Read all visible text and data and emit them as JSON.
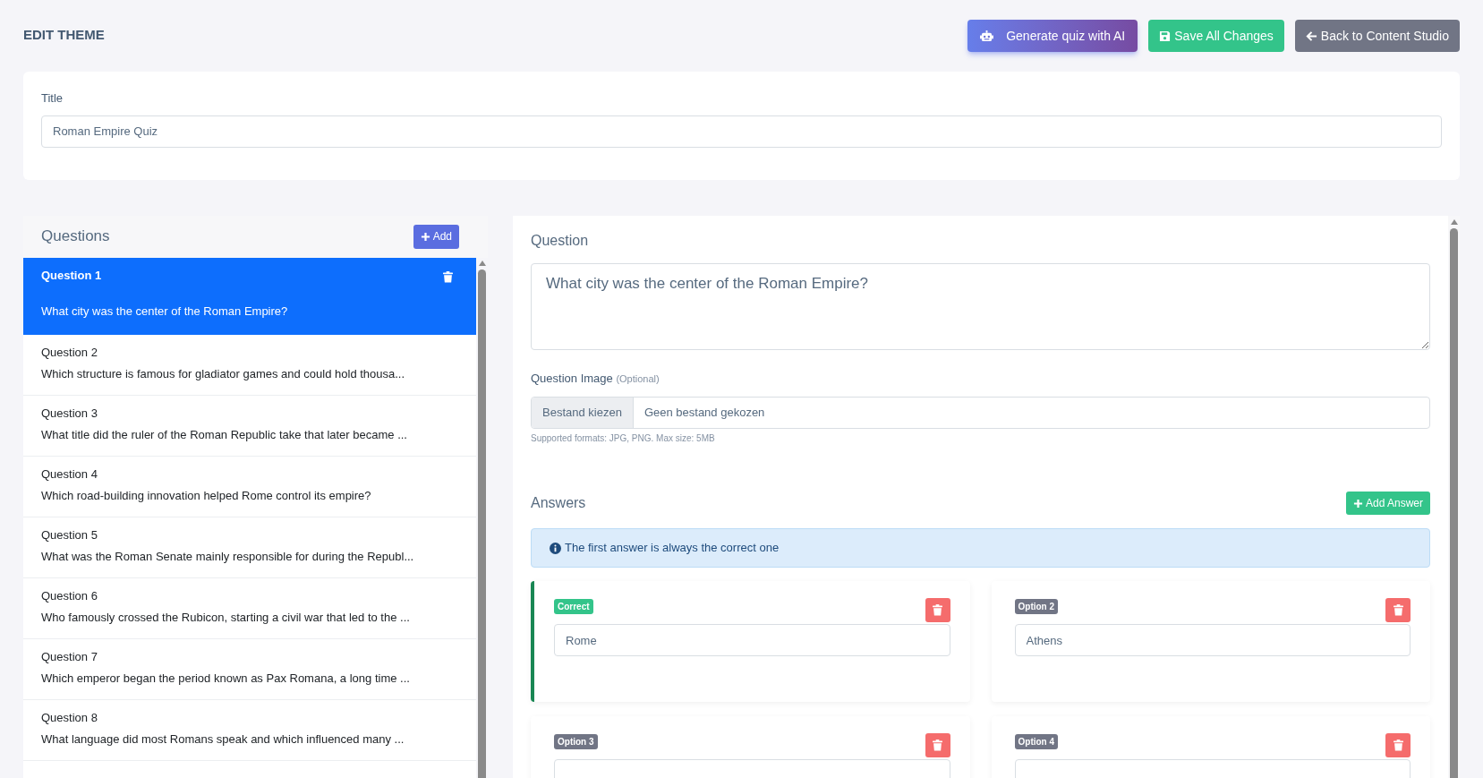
{
  "header": {
    "title": "EDIT THEME",
    "buttons": [
      {
        "kind": "ai",
        "label": "Generate quiz with AI"
      },
      {
        "kind": "save",
        "label": "Save All Changes"
      },
      {
        "kind": "back",
        "label": "Back to Content Studio"
      }
    ]
  },
  "title_field": {
    "label": "Title",
    "value": "Roman Empire Quiz"
  },
  "questions": {
    "heading": "Questions",
    "add_button": "Add",
    "items": [
      {
        "title": "Question 1",
        "text": "What city was the center of the Roman Empire?",
        "selected": true
      },
      {
        "title": "Question 2",
        "text": "Which structure is famous for gladiator games and could hold thousa...",
        "selected": false
      },
      {
        "title": "Question 3",
        "text": "What title did the ruler of the Roman Republic take that later became ...",
        "selected": false
      },
      {
        "title": "Question 4",
        "text": "Which road-building innovation helped Rome control its empire?",
        "selected": false
      },
      {
        "title": "Question 5",
        "text": "What was the Roman Senate mainly responsible for during the Republ...",
        "selected": false
      },
      {
        "title": "Question 6",
        "text": "Who famously crossed the Rubicon, starting a civil war that led to the ...",
        "selected": false
      },
      {
        "title": "Question 7",
        "text": "Which emperor began the period known as Pax Romana, a long time ...",
        "selected": false
      },
      {
        "title": "Question 8",
        "text": "What language did most Romans speak and which influenced many ...",
        "selected": false
      }
    ]
  },
  "editor": {
    "question_label": "Question",
    "question_text": "What city was the center of the Roman Empire?",
    "image_label": "Question Image",
    "image_optional": "(Optional)",
    "file_button": "Bestand kiezen",
    "file_status": "Geen bestand gekozen",
    "hint": "Supported formats: JPG, PNG. Max size: 5MB",
    "answers_heading": "Answers",
    "add_answer": "Add Answer",
    "info": "The first answer is always the correct one",
    "answers": [
      {
        "badge": "Correct",
        "value": "Rome",
        "correct": true
      },
      {
        "badge": "Option 2",
        "value": "Athens",
        "correct": false
      },
      {
        "badge": "Option 3",
        "correct": false
      },
      {
        "badge": "Option 4",
        "correct": false
      }
    ]
  }
}
